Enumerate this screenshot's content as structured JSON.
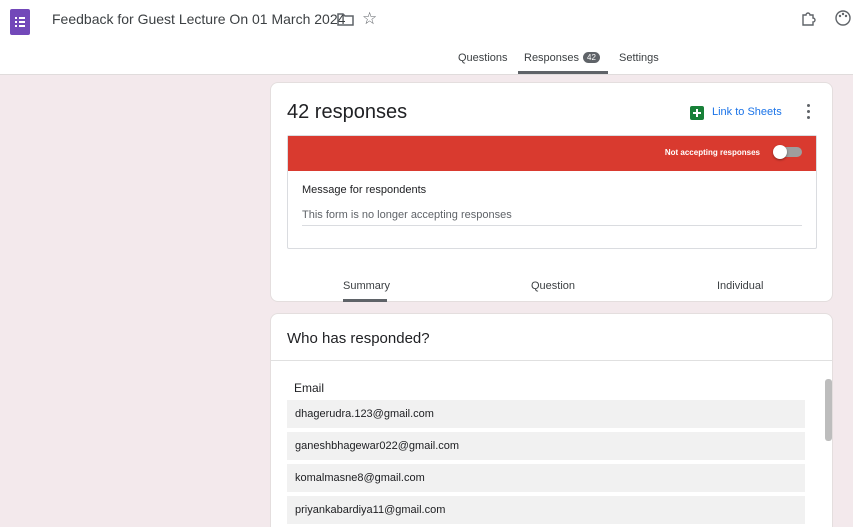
{
  "header": {
    "title": "Feedback for Guest Lecture On 01 March 2024",
    "icons": [
      "forms-app-icon",
      "folder-icon",
      "star-icon",
      "addon-icon",
      "palette-icon"
    ],
    "tabs": [
      {
        "label": "Questions"
      },
      {
        "label": "Responses",
        "badge": "42",
        "active": true
      },
      {
        "label": "Settings"
      }
    ]
  },
  "summary_card": {
    "count_label": "42 responses",
    "sheets_link": "Link to Sheets",
    "banner_text": "Not accepting responses",
    "accepting": false,
    "message_label": "Message for respondents",
    "message_text": "This form is no longer accepting responses",
    "subtabs": [
      "Summary",
      "Question",
      "Individual"
    ],
    "active_subtab": "Summary"
  },
  "respondents_card": {
    "title": "Who has responded?",
    "column_header": "Email",
    "emails": [
      "dhagerudra.123@gmail.com",
      "ganeshbhagewar022@gmail.com",
      "komalmasne8@gmail.com",
      "priyankabardiya11@gmail.com"
    ]
  },
  "colors": {
    "brand": "#7248b9",
    "banner": "#d93a2f",
    "link": "#1a73e8",
    "sheets": "#188038",
    "page_bg": "#f3e9ec"
  }
}
